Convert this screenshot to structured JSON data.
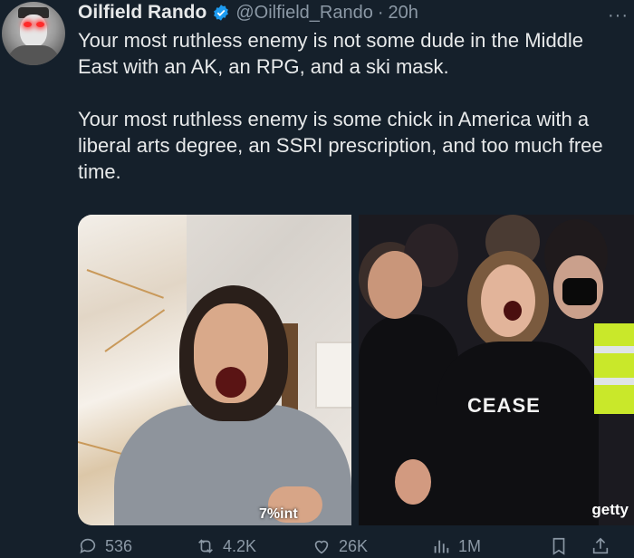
{
  "tweet": {
    "display_name": "Oilfield Rando",
    "handle": "@Oilfield_Rando",
    "separator": "·",
    "time": "20h",
    "more": "···",
    "paragraphs": [
      "Your most ruthless enemy is not some dude in the Middle East with an AK, an RPG, and a ski mask.",
      "Your most ruthless enemy is some chick in America with a liberal arts degree, an SSRI prescription, and too much free time."
    ],
    "media": {
      "left_overlay": "7%int",
      "right_shirt_text": "CEASE",
      "right_watermark": "getty"
    },
    "actions": {
      "replies": "536",
      "reposts": "4.2K",
      "likes": "26K",
      "views": "1M"
    }
  },
  "colors": {
    "background": "#15202b",
    "text": "#e7e9ea",
    "muted": "#8b98a5",
    "verified": "#1d9bf0"
  },
  "icons": [
    "verified-badge-icon",
    "more-icon",
    "reply-icon",
    "repost-icon",
    "like-icon",
    "views-icon",
    "bookmark-icon",
    "share-icon"
  ]
}
